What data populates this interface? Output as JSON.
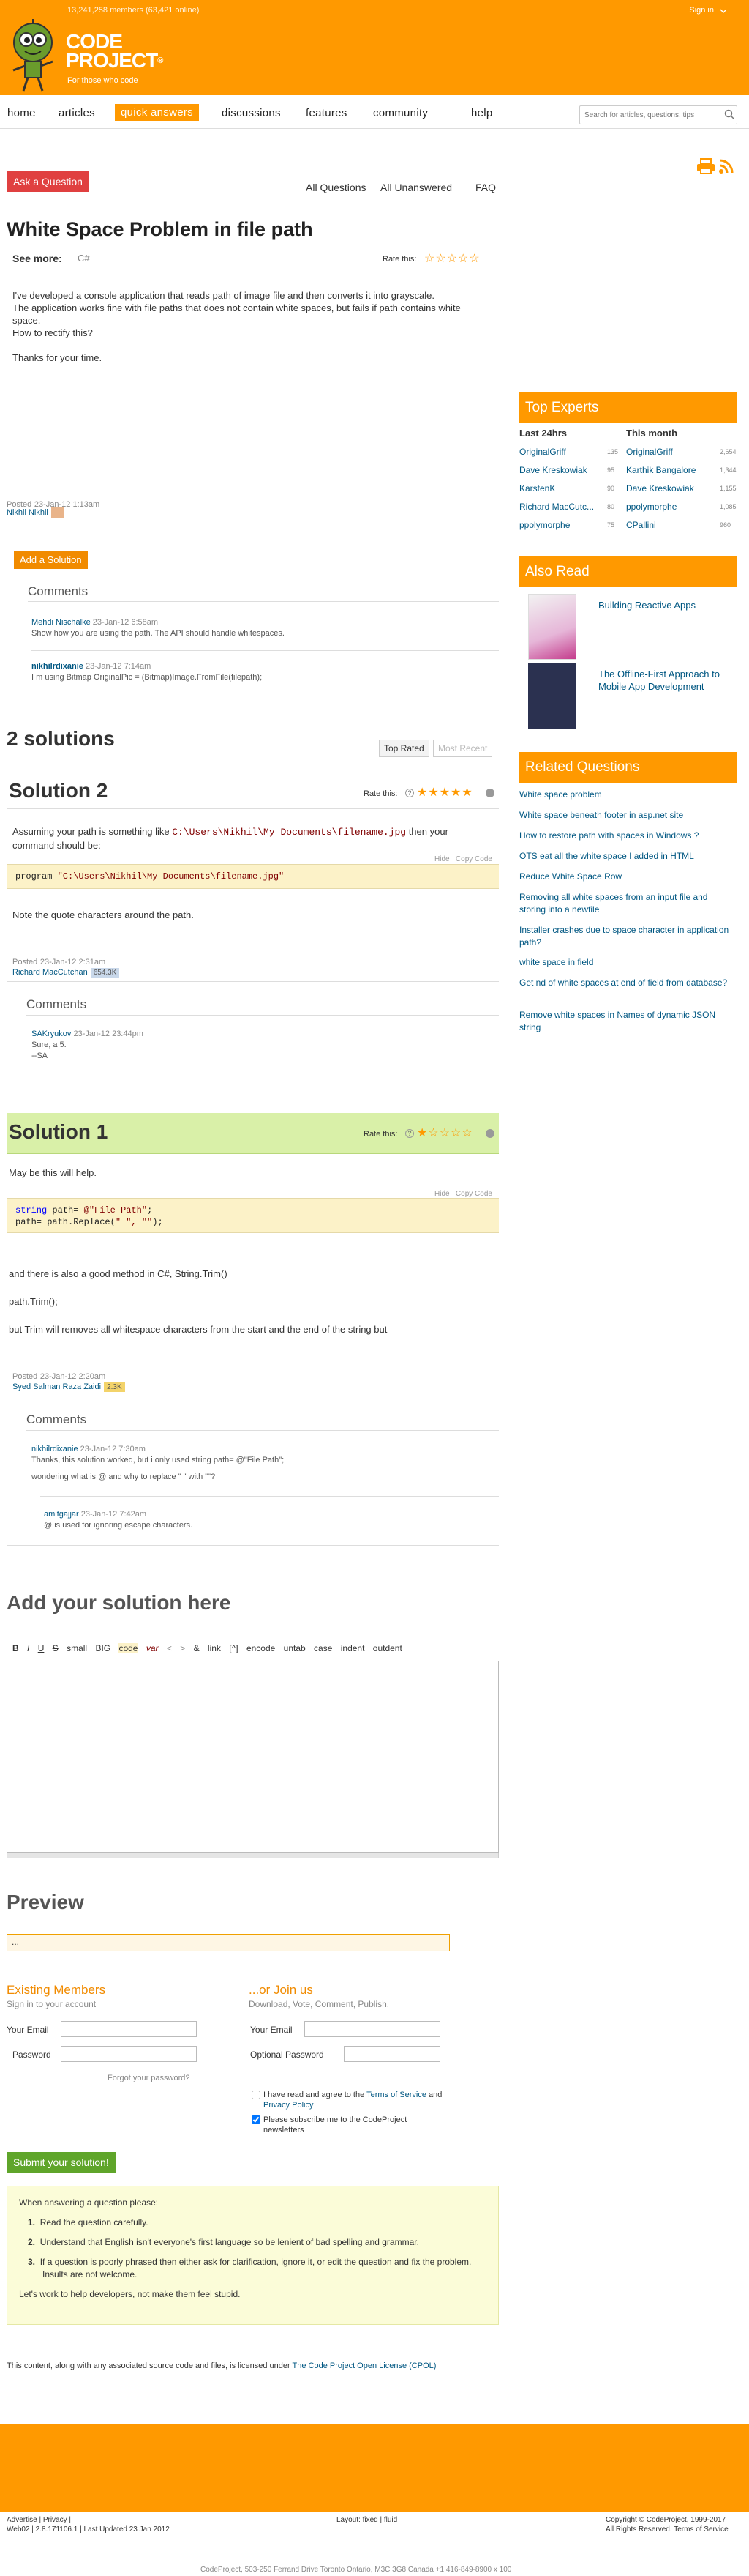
{
  "header": {
    "members_text": "13,241,258 members (63,421 online)",
    "sign_in": "Sign in",
    "logo_line1": "CODE",
    "logo_line2": "PROJECT",
    "logo_reg": "®",
    "tagline": "For those who code"
  },
  "nav": {
    "items": [
      "home",
      "articles",
      "quick answers",
      "discussions",
      "features",
      "community",
      "help"
    ],
    "active": "quick answers",
    "search_placeholder": "Search for articles, questions, tips"
  },
  "question_nav": {
    "ask_button": "Ask a Question",
    "all_questions": "All Questions",
    "all_unanswered": "All Unanswered",
    "faq": "FAQ"
  },
  "question": {
    "title": "White Space Problem in file path",
    "see_more_label": "See more:",
    "tag": "C#",
    "rate_label": "Rate this:",
    "rating_stars": 0,
    "body": [
      "I've developed a console application that reads path of image file and then converts it into grayscale.",
      "The application works fine with file paths that does not contain white spaces, but fails if path contains white",
      "space.",
      "How to rectify this?",
      "",
      "Thanks for your time."
    ],
    "posted_label": "Posted",
    "posted_date": "23-Jan-12 1:13am",
    "author": "Nikhil Nikhil"
  },
  "question_comments": {
    "add_solution": "Add a Solution",
    "title": "Comments",
    "items": [
      {
        "author": "Mehdi Nischalke",
        "date": "23-Jan-12 6:58am",
        "text": "Show how you are using the path. The API should handle whitespaces."
      },
      {
        "author": "nikhilrdixanie",
        "date": "23-Jan-12 7:14am",
        "text": "I m using Bitmap OriginalPic = (Bitmap)Image.FromFile(filepath);"
      }
    ]
  },
  "solutions": {
    "count_title": "2 solutions",
    "tab_top": "Top Rated",
    "tab_recent": "Most Recent"
  },
  "solution2": {
    "title": "Solution 2",
    "rate_label": "Rate this:",
    "rating_stars": 5,
    "intro_before": "Assuming your path is something like ",
    "path": "C:\\Users\\Nikhil\\My Documents\\filename.jpg",
    "intro_after": " then your",
    "intro_line2": "command should be:",
    "hide": "Hide",
    "copy": "Copy Code",
    "code_keyword": "program ",
    "code_string": "\"C:\\Users\\Nikhil\\My Documents\\filename.jpg\"",
    "note": "Note the quote characters around the path.",
    "posted_label": "Posted",
    "posted_date": "23-Jan-12 2:31am",
    "author": "Richard MacCutchan",
    "rep": "654.3K",
    "comments_title": "Comments",
    "comment_author": "SAKryukov",
    "comment_date": "23-Jan-12 23:44pm",
    "comment_line1": "Sure, a 5.",
    "comment_line2": "--SA"
  },
  "solution1": {
    "title": "Solution 1",
    "rate_label": "Rate this:",
    "rating_stars": 1,
    "intro": "May be this will help.",
    "hide": "Hide",
    "copy": "Copy Code",
    "code_line1_kw": "string ",
    "code_line1_rest": "path= ",
    "code_line1_str": "@\"File Path\"",
    "code_line1_end": ";",
    "code_line2_a": "path= path.Replace(",
    "code_line2_str": "\" \", \"\"",
    "code_line2_end": ");",
    "text1": "and there is also a good method in C#, String.Trim()",
    "text2": "path.Trim();",
    "text3": "but Trim will removes all whitespace characters from the start and the end of the string but",
    "posted_label": "Posted",
    "posted_date": "23-Jan-12 2:20am",
    "author": "Syed Salman Raza Zaidi",
    "rep": "2.3K",
    "comments_title": "Comments",
    "comments": [
      {
        "author": "nikhilrdixanie",
        "date": "23-Jan-12 7:30am",
        "text": "Thanks, this solution worked, but i only used string path= @\"File Path\";",
        "text2": "wondering what is @ and why to replace \" \" with \"\"?"
      },
      {
        "author": "amitgajjar",
        "date": "23-Jan-12 7:42am",
        "text": "@ is used for ignoring escape characters.",
        "text2": ""
      }
    ]
  },
  "add_solution": {
    "title": "Add your solution here",
    "toolbar": [
      "B",
      "I",
      "U",
      "S",
      "small",
      "BIG",
      "code",
      "var",
      "<",
      ">",
      "&",
      "link",
      "[^]",
      "encode",
      "untab",
      "case",
      "indent",
      "outdent"
    ],
    "preview_title": "Preview",
    "preview_text": "...",
    "existing_title": "Existing Members",
    "existing_sub": "Sign in to your account",
    "email_label": "Your Email",
    "password_label": "Password",
    "forgot": "Forgot your password?",
    "join_title": "...or Join us",
    "join_sub": "Download, Vote, Comment, Publish.",
    "join_email_label": "Your Email",
    "optional_password_label": "Optional Password",
    "terms_before": "I have read and agree to the ",
    "terms_link": "Terms of Service",
    "terms_and": " and",
    "privacy_link": "Privacy Policy",
    "subscribe": "Please subscribe me to the CodeProject newsletters",
    "submit": "Submit your solution!"
  },
  "guidelines": {
    "intro": "When answering a question please:",
    "items": [
      "Read the question carefully.",
      "Understand that English isn't everyone's first language so be lenient of bad spelling and grammar.",
      "If a question is poorly phrased then either ask for clarification, ignore it, or edit the question and fix the problem. Insults are not welcome."
    ],
    "outro": "Let's work to help developers, not make them feel stupid."
  },
  "license": {
    "text": "This content, along with any associated source code and files, is licensed under ",
    "link": "The Code Project Open License (CPOL)"
  },
  "footer": {
    "left": "Advertise | Privacy |",
    "left2": "Web02 | 2.8.171106.1 | Last Updated 23 Jan 2012",
    "layout": "Layout: fixed | fluid",
    "right": "Copyright © CodeProject, 1999-2017",
    "right2": "All Rights Reserved. Terms of Service",
    "bottom": "CodeProject, 503-250 Ferrand Drive Toronto Ontario, M3C 3G8 Canada +1 416-849-8900 x 100"
  },
  "top_experts": {
    "title": "Top Experts",
    "col1_title": "Last 24hrs",
    "col2_title": "This month",
    "last24": [
      {
        "name": "OriginalGriff",
        "score": "135"
      },
      {
        "name": "Dave Kreskowiak",
        "score": "95"
      },
      {
        "name": "KarstenK",
        "score": "90"
      },
      {
        "name": "Richard MacCutc...",
        "score": "80"
      },
      {
        "name": "ppolymorphe",
        "score": "75"
      }
    ],
    "month": [
      {
        "name": "OriginalGriff",
        "score": "2,654"
      },
      {
        "name": "Karthik Bangalore",
        "score": "1,344"
      },
      {
        "name": "Dave Kreskowiak",
        "score": "1,155"
      },
      {
        "name": "ppolymorphe",
        "score": "1,085"
      },
      {
        "name": "CPallini",
        "score": "960"
      }
    ]
  },
  "also_read": {
    "title": "Also Read",
    "items": [
      "Building Reactive Apps",
      "The Offline-First Approach to Mobile App Development"
    ]
  },
  "related": {
    "title": "Related Questions",
    "items": [
      "White space problem",
      "White space beneath footer in asp.net site",
      "How to restore path with spaces in Windows ?",
      "OTS eat all the white space I added in HTML",
      "Reduce White Space Row",
      "Removing all white spaces from an input file and storing into a newfile",
      "Installer crashes due to space character in application path?",
      "white space in field",
      "Get nd of white spaces at end of field from database?",
      "Remove white spaces in Names of dynamic JSON string"
    ]
  }
}
